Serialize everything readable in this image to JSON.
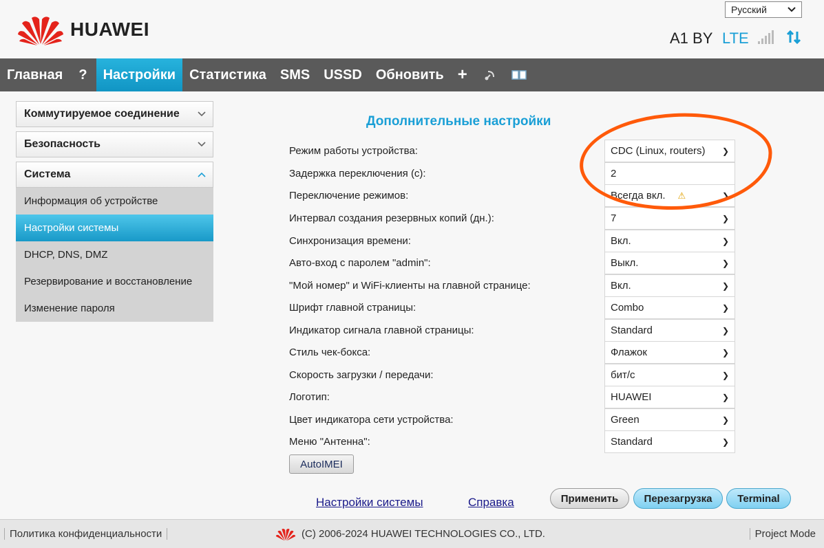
{
  "header": {
    "brand": "HUAWEI",
    "language": "Русский",
    "operator": "A1 BY",
    "network_type": "LTE",
    "network_type_color": "#1a9fd6",
    "signal_bars_filled": 0
  },
  "nav": {
    "items": [
      "Главная",
      "?",
      "Настройки",
      "Статистика",
      "SMS",
      "USSD",
      "Обновить",
      "+"
    ],
    "active": "Настройки",
    "icons": [
      "satellite-icon",
      "book-icon"
    ]
  },
  "sidebar": {
    "groups": [
      {
        "label": "Коммутируемое соединение"
      },
      {
        "label": "Безопасность"
      },
      {
        "label": "Система"
      }
    ],
    "system_items": [
      "Информация об устройстве",
      "Настройки системы",
      "DHCP, DNS, DMZ",
      "Резервирование и восстановление",
      "Изменение пароля"
    ],
    "active_item": "Настройки системы"
  },
  "main": {
    "title": "Дополнительные настройки",
    "rows": [
      {
        "label": "Режим работы устройства:",
        "value": "CDC (Linux, routers)"
      },
      {
        "label": "Задержка переключения (с):",
        "value": "2"
      },
      {
        "label": "Переключение режимов:",
        "value": "Всегда вкл."
      },
      {
        "label": "Интервал создания резервных копий (дн.):",
        "value": "7"
      },
      {
        "label": "Синхронизация времени:",
        "value": "Вкл."
      },
      {
        "label": "Авто-вход с паролем \"admin\":",
        "value": "Выкл."
      },
      {
        "label": "\"Мой номер\" и WiFi-клиенты на главной странице:",
        "value": "Вкл."
      },
      {
        "label": "Шрифт главной страницы:",
        "value": "Combo"
      },
      {
        "label": "Индикатор сигнала главной страницы:",
        "value": "Standard"
      },
      {
        "label": "Стиль чек-бокса:",
        "value": "Флажок"
      },
      {
        "label": "Скорость загрузки / передачи:",
        "value": "бит/с"
      },
      {
        "label": "Логотип:",
        "value": "HUAWEI"
      },
      {
        "label": "Цвет индикатора сети устройства:",
        "value": "Green"
      },
      {
        "label": "Меню \"Антенна\":",
        "value": "Standard"
      }
    ],
    "autoimei_label": "AutoIMEI",
    "links": {
      "system_settings": "Настройки системы",
      "help": "Справка"
    },
    "buttons": {
      "apply": "Применить",
      "reboot": "Перезагрузка",
      "terminal": "Terminal"
    }
  },
  "footer": {
    "privacy": "Политика конфиденциальности",
    "copyright": "(C) 2006-2024 HUAWEI TECHNOLOGIES CO., LTD.",
    "project_mode": "Project Mode"
  },
  "annotation_color": "#ff5a0a"
}
